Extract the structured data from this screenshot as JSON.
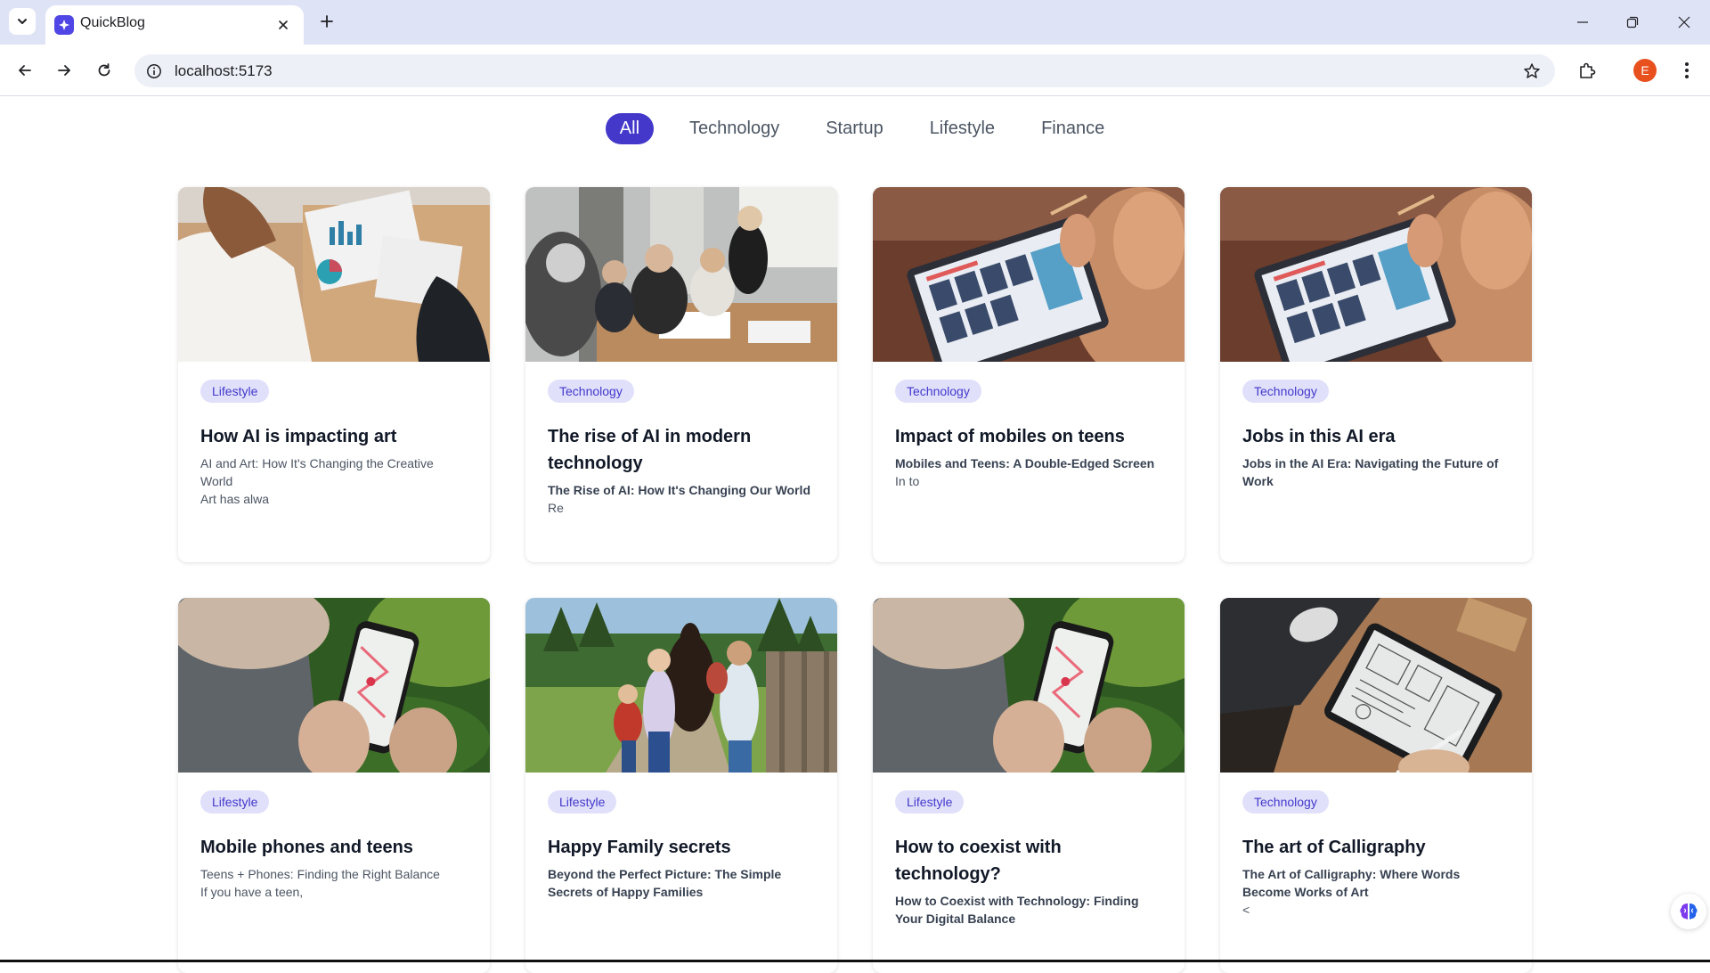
{
  "browser": {
    "tab_title": "QuickBlog",
    "url": "localhost:5173",
    "profile_initial": "E",
    "icons": [
      "tab-search-icon",
      "favicon-icon",
      "close-icon",
      "plus-icon",
      "minimize-icon",
      "restore-icon",
      "close-window-icon",
      "back-icon",
      "forward-icon",
      "reload-icon",
      "info-icon",
      "star-icon",
      "extensions-icon",
      "kebab-menu-icon"
    ]
  },
  "filters": [
    {
      "label": "All",
      "active": true
    },
    {
      "label": "Technology",
      "active": false
    },
    {
      "label": "Startup",
      "active": false
    },
    {
      "label": "Lifestyle",
      "active": false
    },
    {
      "label": "Finance",
      "active": false
    }
  ],
  "posts": [
    {
      "category": "Lifestyle",
      "title": "How AI is impacting art",
      "excerpt_bold": "",
      "excerpt_lines": [
        "AI and Art: How It's Changing the Creative World",
        "Art has alwa"
      ],
      "image": "meeting-charts-photo"
    },
    {
      "category": "Technology",
      "title": "The rise of AI in modern technology",
      "excerpt_bold": "The Rise of AI: How It's Changing Our World",
      "excerpt_lines": [
        "Re"
      ],
      "image": "business-team-photo"
    },
    {
      "category": "Technology",
      "title": "Impact of mobiles on teens",
      "excerpt_bold": "Mobiles and Teens: A Double-Edged Screen",
      "excerpt_lines": [
        "In to"
      ],
      "image": "tablet-design-photo"
    },
    {
      "category": "Technology",
      "title": "Jobs in this AI era",
      "excerpt_bold": "Jobs in the AI Era: Navigating the Future of Work",
      "excerpt_lines": [],
      "image": "tablet-design-photo"
    },
    {
      "category": "Lifestyle",
      "title": "Mobile phones and teens",
      "excerpt_bold": "",
      "excerpt_lines": [
        "Teens + Phones: Finding the Right Balance",
        "If you have a teen,"
      ],
      "image": "phone-map-photo"
    },
    {
      "category": "Lifestyle",
      "title": "Happy Family secrets",
      "excerpt_bold": "Beyond the Perfect Picture: The Simple Secrets of Happy Families",
      "excerpt_lines": [],
      "image": "family-horse-photo"
    },
    {
      "category": "Lifestyle",
      "title": "How to coexist with technology?",
      "excerpt_bold": "How to Coexist with Technology: Finding Your Digital Balance",
      "excerpt_lines": [],
      "image": "phone-map-photo"
    },
    {
      "category": "Technology",
      "title": "The art of Calligraphy",
      "excerpt_bold": "The Art of Calligraphy: Where Words Become Works of Art",
      "excerpt_lines": [
        "<"
      ],
      "image": "tablet-sketch-photo"
    }
  ],
  "colors": {
    "accent": "#4338ca",
    "badge_bg": "#e0e0fb",
    "tabbar_bg": "#dfe3f6"
  }
}
